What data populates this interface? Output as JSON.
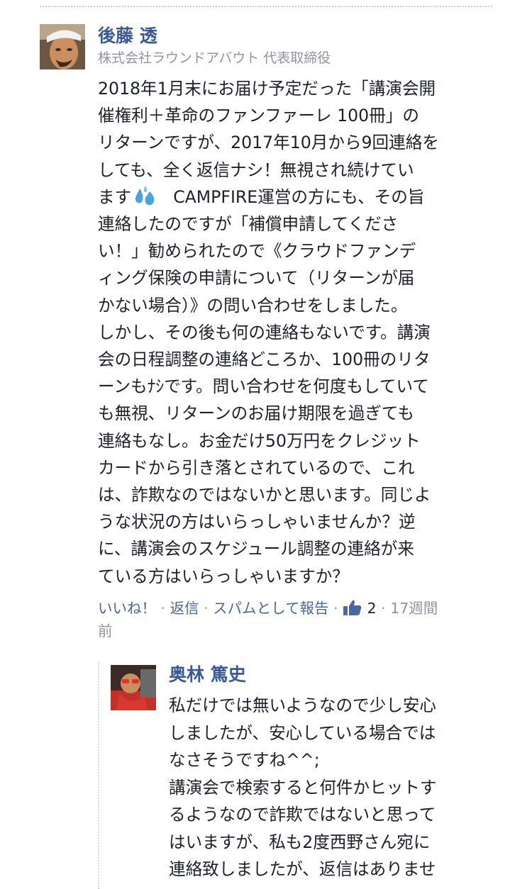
{
  "comment": {
    "author": "後藤 透",
    "subtitle": "株式会社ラウンドアバウト 代表取締役",
    "text_lines": [
      "2018年1月末にお届け予定だった「講演会開",
      "催権利＋革命のファンファーレ 100冊」の",
      "リターンですが、2017年10月から9回連絡を",
      "しても、全く返信ナシ！無視され続けてい"
    ],
    "text_line5_before_icon": "ます",
    "text_line5_after_icon": "CAMPFIRE運営の方にも、その旨",
    "text_lines_rest": [
      "連絡したのですが「補償申請してくださ",
      "い！」勧められたので《クラウドファンデ",
      "ィング保険の申請について（リターンが届",
      "かない場合）》の問い合わせをしました。",
      "しかし、その後も何の連絡もないです。講演",
      "会の日程調整の連絡どころか、100冊のリタ",
      "ーンもﾅｼです。問い合わせを何度もしていて",
      "も無視、リターンのお届け期限を過ぎても",
      "連絡もなし。お金だけ50万円をクレジット",
      "カードから引き落とされているので、これ",
      "は、詐欺なのではないかと思います。同じよ",
      "うな状況の方はいらっしゃいませんか？逆",
      "に、講演会のスケジュール調整の連絡が来",
      "ている方はいらっしゃいますか？"
    ],
    "actions": {
      "like": "いいね！",
      "sep": " · ",
      "reply": "返信",
      "report": "スパムとして報告",
      "like_count": "2",
      "time_line1": "17週間",
      "time_line2": "前"
    },
    "icons": [
      "avatar-photo",
      "sweat-drops-icon",
      "thumbs-up-icon"
    ]
  },
  "reply": {
    "author": "奥林 篤史",
    "text_lines": [
      "私だけでは無いようなので少し安心",
      "しましたが、安心している場合では",
      "なさそうですね^^;",
      "講演会で検索すると何件かヒットす",
      "るようなので詐欺ではないと思って",
      "はいますが、私も2度西野さん宛に",
      "連絡致しましたが、返信はありませ"
    ]
  },
  "colors": {
    "link": "#3b5998",
    "action_link": "#4b67a1",
    "meta": "#90949c",
    "text": "#1d2129",
    "sweat": "#4aa3e0"
  }
}
